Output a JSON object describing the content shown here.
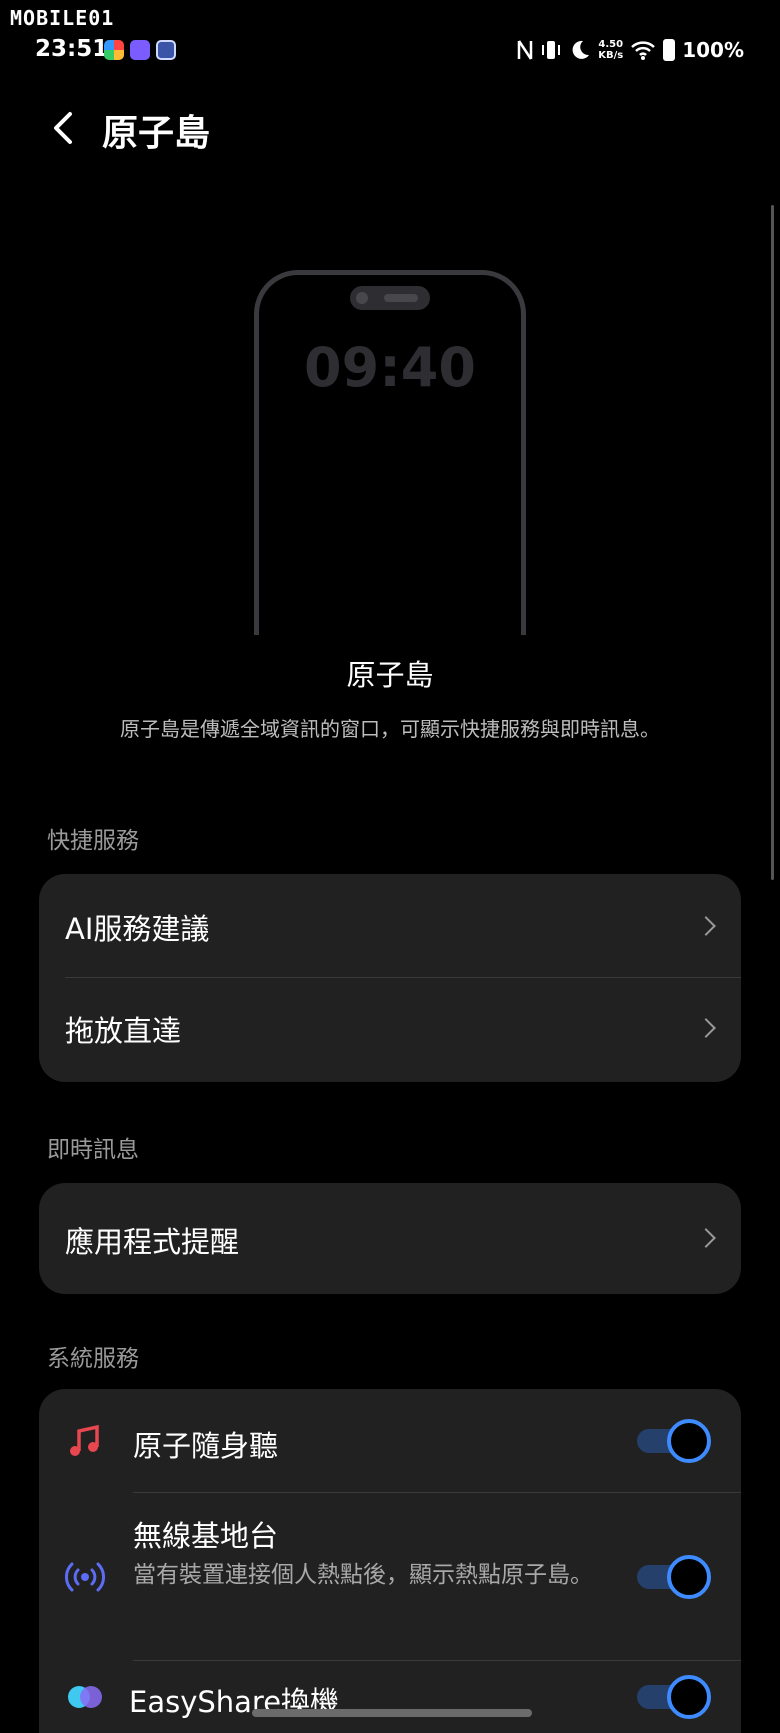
{
  "watermark": "MOBILE01",
  "status_bar": {
    "time": "23:51",
    "net_speed_value": "4.50",
    "net_speed_unit": "KB/s",
    "battery": "100%"
  },
  "header": {
    "title": "原子島"
  },
  "preview": {
    "clock": "09:40"
  },
  "feature": {
    "title": "原子島",
    "description": "原子島是傳遞全域資訊的窗口，可顯示快捷服務與即時訊息。"
  },
  "sections": {
    "quick_services": {
      "label": "快捷服務",
      "items": [
        {
          "label": "AI服務建議"
        },
        {
          "label": "拖放直達"
        }
      ]
    },
    "live_messages": {
      "label": "即時訊息",
      "items": [
        {
          "label": "應用程式提醒"
        }
      ]
    },
    "system_services": {
      "label": "系統服務",
      "items": [
        {
          "label": "原子隨身聽",
          "icon": "music-note-icon",
          "enabled": true
        },
        {
          "label": "無線基地台",
          "icon": "hotspot-icon",
          "subtitle": "當有裝置連接個人熱點後，顯示熱點原子島。",
          "enabled": true
        },
        {
          "label": "EasyShare換機",
          "icon": "easyshare-icon",
          "enabled": true
        }
      ]
    }
  },
  "colors": {
    "accent": "#3d8bff",
    "toggle_track": "#25406b",
    "card_bg": "#212121",
    "music_icon": "#e8474f",
    "hotspot_icon": "#5b6cf6"
  }
}
